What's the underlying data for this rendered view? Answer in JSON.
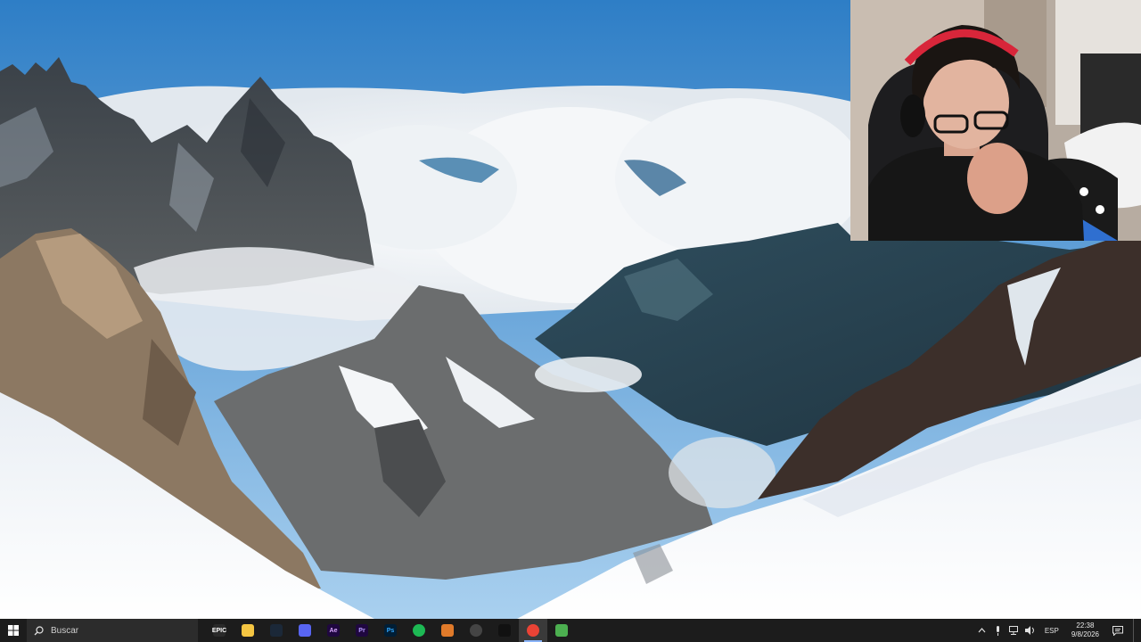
{
  "taskbar": {
    "search_placeholder": "Buscar",
    "apps": [
      {
        "name": "epic-games",
        "label": "EPIC",
        "bg": "#2a2a2a",
        "fg": "#ffffff"
      },
      {
        "name": "file-explorer",
        "label": "",
        "bg": "#f4c542",
        "fg": "#000000"
      },
      {
        "name": "steam",
        "label": "",
        "bg": "#1b2838",
        "fg": "#66c0f4"
      },
      {
        "name": "discord",
        "label": "",
        "bg": "#5865f2",
        "fg": "#ffffff"
      },
      {
        "name": "after-effects",
        "label": "Ae",
        "bg": "#1f0740",
        "fg": "#d9a7ff"
      },
      {
        "name": "premiere-pro",
        "label": "Pr",
        "bg": "#1f0740",
        "fg": "#b59cff"
      },
      {
        "name": "photoshop",
        "label": "Ps",
        "bg": "#001e36",
        "fg": "#31a8ff"
      },
      {
        "name": "spotify",
        "label": "",
        "bg": "#1db954",
        "fg": "#000000"
      },
      {
        "name": "app-orange",
        "label": "",
        "bg": "#e07a2a",
        "fg": "#ffffff"
      },
      {
        "name": "app-circle",
        "label": "",
        "bg": "#444444",
        "fg": "#ffffff"
      },
      {
        "name": "tiktok",
        "label": "",
        "bg": "#111111",
        "fg": "#ff2d55"
      },
      {
        "name": "chrome",
        "label": "",
        "bg": "#ea4335",
        "fg": "#ffffff"
      },
      {
        "name": "minecraft",
        "label": "",
        "bg": "#4caf50",
        "fg": "#ffffff"
      }
    ],
    "active_app": "chrome",
    "tray": {
      "language": "ESP",
      "time": "22:38",
      "date": "9/8/2026"
    }
  },
  "icons": {
    "start": "windows-logo-icon",
    "search": "search-icon",
    "tray_chevron": "chevron-up-icon",
    "mic": "microphone-icon",
    "network": "network-icon",
    "speaker": "volume-icon",
    "notifications": "notification-icon"
  },
  "colors": {
    "taskbar_bg": "#1c1c1c",
    "search_bg": "#2c2c2c",
    "active_indicator": "#8ab4f8"
  }
}
